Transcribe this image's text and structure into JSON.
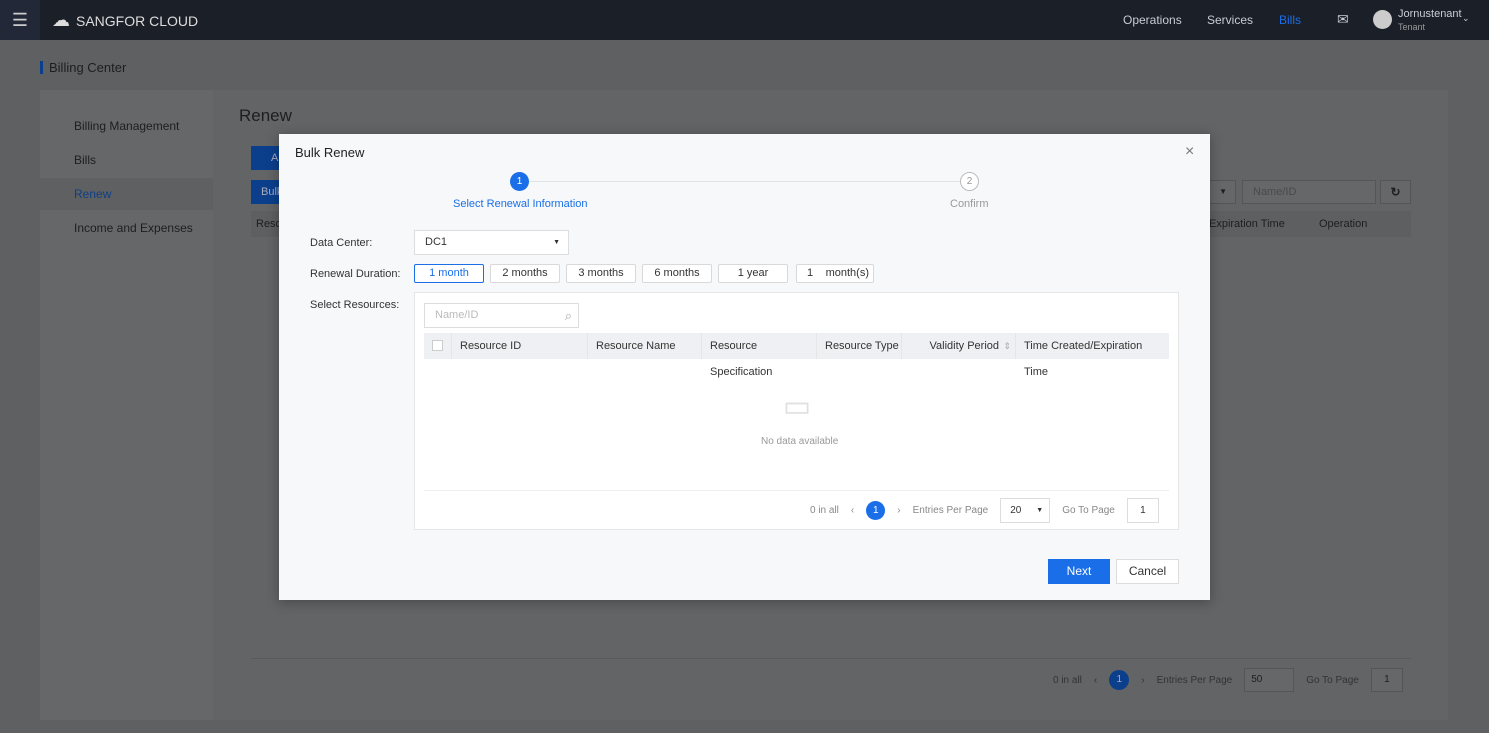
{
  "header": {
    "brand": "SANGFOR CLOUD",
    "nav": [
      "Operations",
      "Services",
      "Bills"
    ],
    "user": "Jornustenant",
    "role": "Tenant",
    "accent": "#1a6fe8"
  },
  "page": {
    "breadcrumb": "Billing Center",
    "title": "Renew",
    "btn_all": "All",
    "btn_bulk": "Bulk",
    "search_placeholder": "Name/ID",
    "col_resource": "Reso",
    "col_expiration": "Expiration Time",
    "col_operation": "Operation",
    "pagination": {
      "total": "0 in all",
      "page": "1",
      "entries_label": "Entries Per Page",
      "entries": "50",
      "goto_label": "Go To Page",
      "goto": "1"
    }
  },
  "sidebar": {
    "items": [
      {
        "label": "Billing Management",
        "icon": "document-icon"
      },
      {
        "label": "Bills",
        "icon": "save-icon"
      },
      {
        "label": "Renew",
        "icon": "dollar-icon",
        "active": true
      },
      {
        "label": "Income and Expenses",
        "icon": "pie-icon"
      }
    ]
  },
  "modal": {
    "title": "Bulk Renew",
    "steps": [
      {
        "num": "1",
        "label": "Select Renewal Information"
      },
      {
        "num": "2",
        "label": "Confirm"
      }
    ],
    "data_center_label": "Data Center:",
    "data_center": "DC1",
    "duration_label": "Renewal Duration:",
    "durations": [
      "1 month",
      "2 months",
      "3 months",
      "6 months",
      "1 year"
    ],
    "custom_value": "1",
    "custom_unit": "month(s)",
    "resources_label": "Select Resources:",
    "search_placeholder": "Name/ID",
    "columns": [
      "Resource ID",
      "Resource Name",
      "Resource Specification",
      "Resource Type",
      "Validity Period",
      "Time Created/Expiration Time"
    ],
    "empty": "No data available",
    "pagination": {
      "total": "0 in all",
      "page": "1",
      "entries_label": "Entries Per Page",
      "entries": "20",
      "goto_label": "Go To Page",
      "goto": "1"
    },
    "next": "Next",
    "cancel": "Cancel"
  }
}
